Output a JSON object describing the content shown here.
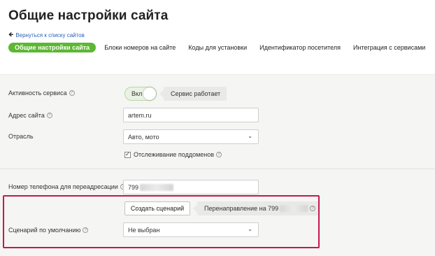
{
  "page": {
    "title": "Общие настройки сайта",
    "back_link": "Вернуться к списку сайтов"
  },
  "tabs": [
    {
      "label": "Общие настройки сайта",
      "active": true
    },
    {
      "label": "Блоки номеров на сайте",
      "active": false
    },
    {
      "label": "Коды для установки",
      "active": false
    },
    {
      "label": "Идентификатор посетителя",
      "active": false
    },
    {
      "label": "Интеграция с сервисами",
      "active": false
    }
  ],
  "settings": {
    "service_activity": {
      "label": "Активность сервиса",
      "toggle_label": "Вкл",
      "toggle_on": true,
      "status": "Сервис работает"
    },
    "site_address": {
      "label": "Адрес сайта",
      "value": "artem.ru"
    },
    "industry": {
      "label": "Отрасль",
      "value": "Авто, мото"
    },
    "subdomain_tracking": {
      "label": "Отслеживание поддоменов",
      "checked": true
    },
    "redirect_phone": {
      "label": "Номер телефона для переадресации",
      "value": "799"
    },
    "scenario": {
      "create_button": "Создать сценарий",
      "redirect_badge": "Перенаправление на 799",
      "default_label": "Сценарий по умолчанию",
      "default_value": "Не выбран"
    }
  },
  "icons": {
    "back": "arrow-left-icon",
    "help": "help-icon",
    "dropdown": "chevron-down-icon",
    "check": "check-icon"
  },
  "colors": {
    "accent_green": "#5cb832",
    "link_blue": "#2a62b8",
    "highlight_red": "#c8174f"
  }
}
